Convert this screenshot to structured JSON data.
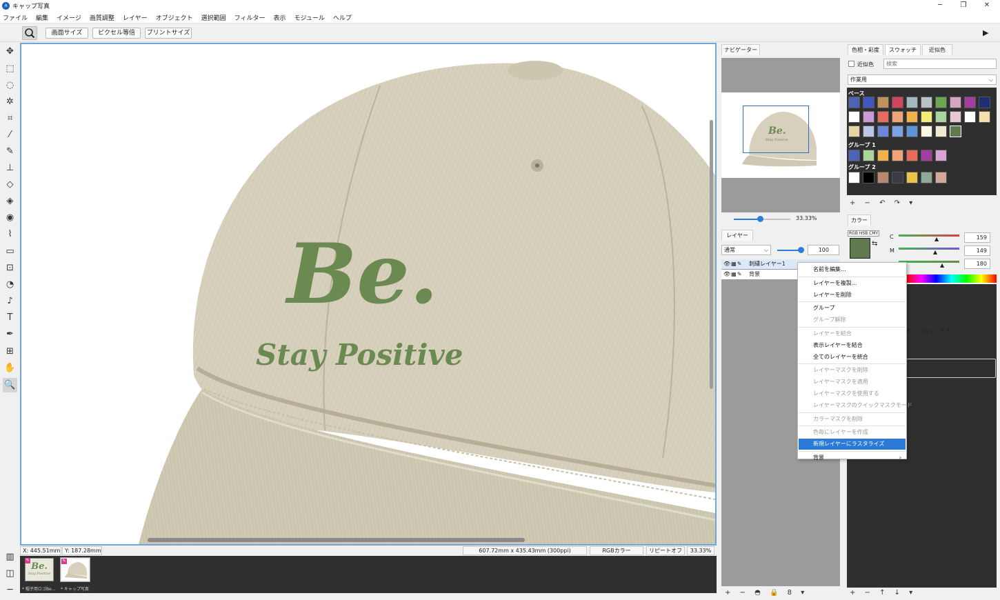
{
  "window": {
    "title": "キャップ写真"
  },
  "menu": [
    "ファイル",
    "編集",
    "イメージ",
    "画質調整",
    "レイヤー",
    "オブジェクト",
    "選択範囲",
    "フィルター",
    "表示",
    "モジュール",
    "ヘルプ"
  ],
  "options": {
    "fit_screen": "画面サイズ",
    "pixel_equal": "ピクセル等倍",
    "print_size": "プリントサイズ"
  },
  "canvas_text": {
    "logo": "Be.",
    "tagline": "Stay Positive"
  },
  "status": {
    "x": "X: 445.51mm",
    "y": "Y: 187.28mm",
    "size": "607.72mm x 435.43mm (300ppi)",
    "color_mode": "RGBカラー",
    "repeat": "リピートオフ",
    "zoom": "33.33%"
  },
  "doc_tabs": [
    {
      "label": "* 帽子用ロゴBe...",
      "thumb_text": "Be.",
      "thumb_sub": "Stay Positive"
    },
    {
      "label": "* キャップ写真"
    }
  ],
  "navigator": {
    "tab": "ナビゲーター",
    "zoom": "33.33%",
    "thumb_text": "Be.",
    "thumb_sub": "Stay Positive"
  },
  "layers": {
    "tab": "レイヤー",
    "blend_mode": "通常",
    "opacity": "100",
    "items": [
      {
        "name": "刺繍レイヤー1",
        "selected": true
      },
      {
        "name": "背景",
        "selected": false
      }
    ],
    "bottom_icons": "+ − ◓ 🔒 8 ▾"
  },
  "right_tabs": [
    "色相・彩度",
    "スウォッチ",
    "近似色"
  ],
  "swatches": {
    "similar_label": "近似色",
    "search_placeholder": "検索",
    "set": "作業用",
    "base_label": "ベース",
    "group1_label": "グループ 1",
    "group2_label": "グループ 2",
    "base_colors": [
      "#4b64b8",
      "#3f58c0",
      "#c0925a",
      "#d2455e",
      "#9fb8c2",
      "#b8c2c4",
      "#6aa84f",
      "#d6a5c0",
      "#a33ea0",
      "#1f2e72",
      "#ffffff",
      "#c99ad6",
      "#e86b5c",
      "#f1a47a",
      "#f2b24b",
      "#f4ee76",
      "#a8d59c",
      "#e8c8d0",
      "#ffffff",
      "#f4dfae",
      "#e6d4a6",
      "#b8c8e6",
      "#6f86d6",
      "#7aa2e4",
      "#5c93d9",
      "#fbf7e0",
      "#f2ead0",
      "#5f7a4e"
    ],
    "group1_colors": [
      "#4b64b8",
      "#a8d59c",
      "#f2b24b",
      "#f1a47a",
      "#e86b5c",
      "#a33ea0",
      "#d6a5d6"
    ],
    "group2_colors": [
      "#ffffff",
      "#000000",
      "#b8896c",
      "#3b3b48",
      "#e8c44a",
      "#8ea89a",
      "#d4a89a"
    ],
    "bottom_icons": "+ − ↶ ↷ ▾"
  },
  "color_panel": {
    "tab": "カラー",
    "modes": "RGB HSB CMY",
    "c_label": "C",
    "m_label": "M",
    "c_value": "159",
    "m_value": "149",
    "y_value": "180",
    "clear_label": "クリア",
    "fg_color": "#5f7a4e"
  },
  "right_bottom_icons": "+ − ↑ ↓ ▾",
  "context_menu": [
    {
      "label": "名前を編集...",
      "disabled": false
    },
    {
      "sep": true
    },
    {
      "label": "レイヤーを複製...",
      "disabled": false
    },
    {
      "label": "レイヤーを削除",
      "disabled": false
    },
    {
      "sep": true
    },
    {
      "label": "グループ",
      "disabled": false
    },
    {
      "label": "グループ解除",
      "disabled": true
    },
    {
      "sep": true
    },
    {
      "label": "レイヤーを結合",
      "disabled": true
    },
    {
      "label": "表示レイヤーを結合",
      "disabled": false
    },
    {
      "label": "全てのレイヤーを統合",
      "disabled": false
    },
    {
      "sep": true
    },
    {
      "label": "レイヤーマスクを削除",
      "disabled": true
    },
    {
      "label": "レイヤーマスクを適用",
      "disabled": true
    },
    {
      "label": "レイヤーマスクを使用する",
      "disabled": true
    },
    {
      "label": "レイヤーマスクのクイックマスクモード",
      "disabled": true
    },
    {
      "sep": true
    },
    {
      "label": "カラーマスクを削除",
      "disabled": true
    },
    {
      "sep": true
    },
    {
      "label": "色毎にレイヤーを作成",
      "disabled": true
    },
    {
      "label": "新規レイヤーにラスタライズ",
      "disabled": false,
      "highlight": true
    },
    {
      "sep": true
    },
    {
      "label": "背景",
      "disabled": false,
      "submenu": true
    }
  ]
}
